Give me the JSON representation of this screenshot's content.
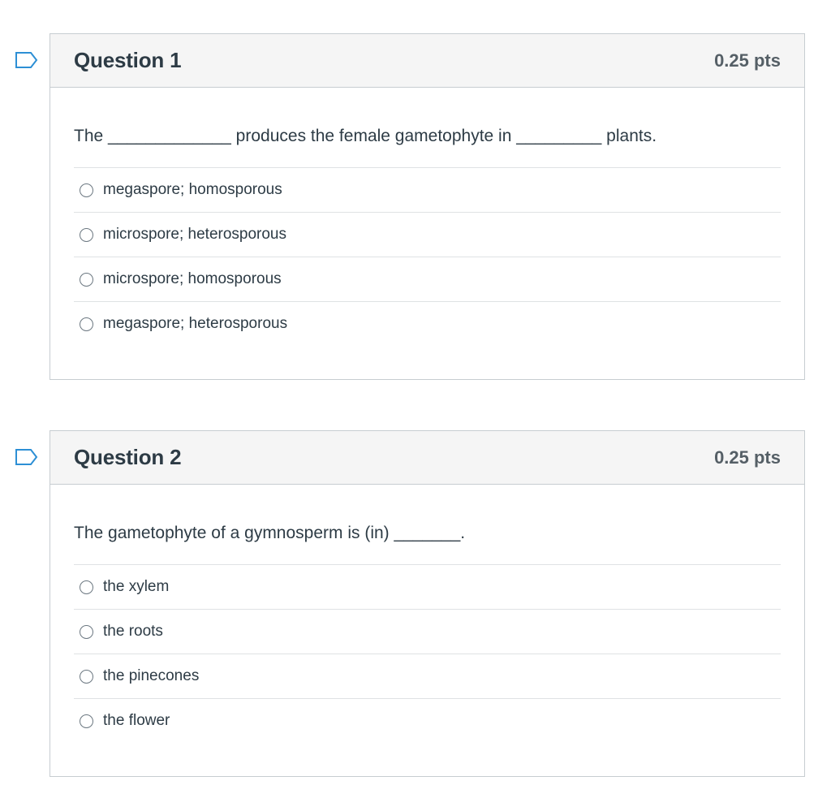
{
  "questions": [
    {
      "title": "Question 1",
      "points": "0.25 pts",
      "text": "The _____________ produces the female gametophyte in _________ plants.",
      "answers": [
        {
          "label": "megaspore; homosporous"
        },
        {
          "label": "microspore; heterosporous"
        },
        {
          "label": "microspore; homosporous"
        },
        {
          "label": "megaspore; heterosporous"
        }
      ]
    },
    {
      "title": "Question 2",
      "points": "0.25 pts",
      "text": "The gametophyte of a gymnosperm is (in) _______.",
      "answers": [
        {
          "label": "the xylem"
        },
        {
          "label": "the roots"
        },
        {
          "label": "the pinecones"
        },
        {
          "label": "the flower"
        }
      ]
    }
  ],
  "icons": {
    "flag": "bookmark-flag-icon"
  },
  "colors": {
    "header_bg": "#f5f5f5",
    "border": "#c7cdd1",
    "text": "#2d3b45",
    "flag_stroke": "#2d8fd5"
  }
}
